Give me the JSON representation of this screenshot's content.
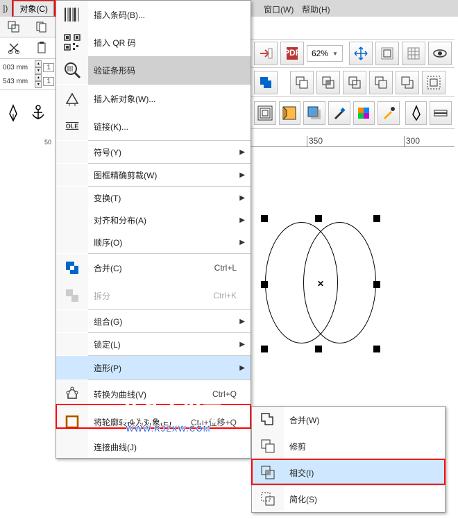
{
  "topbar": {
    "left_item": "])",
    "object_menu": "对象(C)"
  },
  "menubar": {
    "window": "窗口(W)",
    "help": "帮助(H)"
  },
  "toolbar": {
    "zoom": "62%"
  },
  "props": {
    "w": "003 mm",
    "wval": "1",
    "h": "543 mm",
    "hval": "1"
  },
  "ruler": {
    "left": "50",
    "t1": "350",
    "t2": "300"
  },
  "menu": {
    "insert_barcode": "插入条码(B)...",
    "insert_qr": "插入 QR 码",
    "validate_barcode": "验证条形码",
    "insert_new_obj": "插入新对象(W)...",
    "links": "链接(K)...",
    "symbol": "符号(Y)",
    "powerclip": "图框精确剪裁(W)",
    "transform": "变换(T)",
    "align": "对齐和分布(A)",
    "order": "顺序(O)",
    "combine": "合并(C)",
    "combine_sc": "Ctrl+L",
    "break": "拆分",
    "break_sc": "Ctrl+K",
    "group": "组合(G)",
    "lock": "锁定(L)",
    "shaping": "造形(P)",
    "to_curves": "转换为曲线(V)",
    "to_curves_sc": "Ctrl+Q",
    "outline_to_obj": "将轮廓转换为对象(E)",
    "outline_sc": "Ctrl+位移+Q",
    "join_curves": "连接曲线(J)"
  },
  "submenu": {
    "weld": "合并(W)",
    "trim": "修剪",
    "intersect": "相交(I)",
    "simplify": "简化(S)"
  },
  "watermark": {
    "cn": "软件自学网",
    "url": "WWW.RJZXW.COM"
  }
}
